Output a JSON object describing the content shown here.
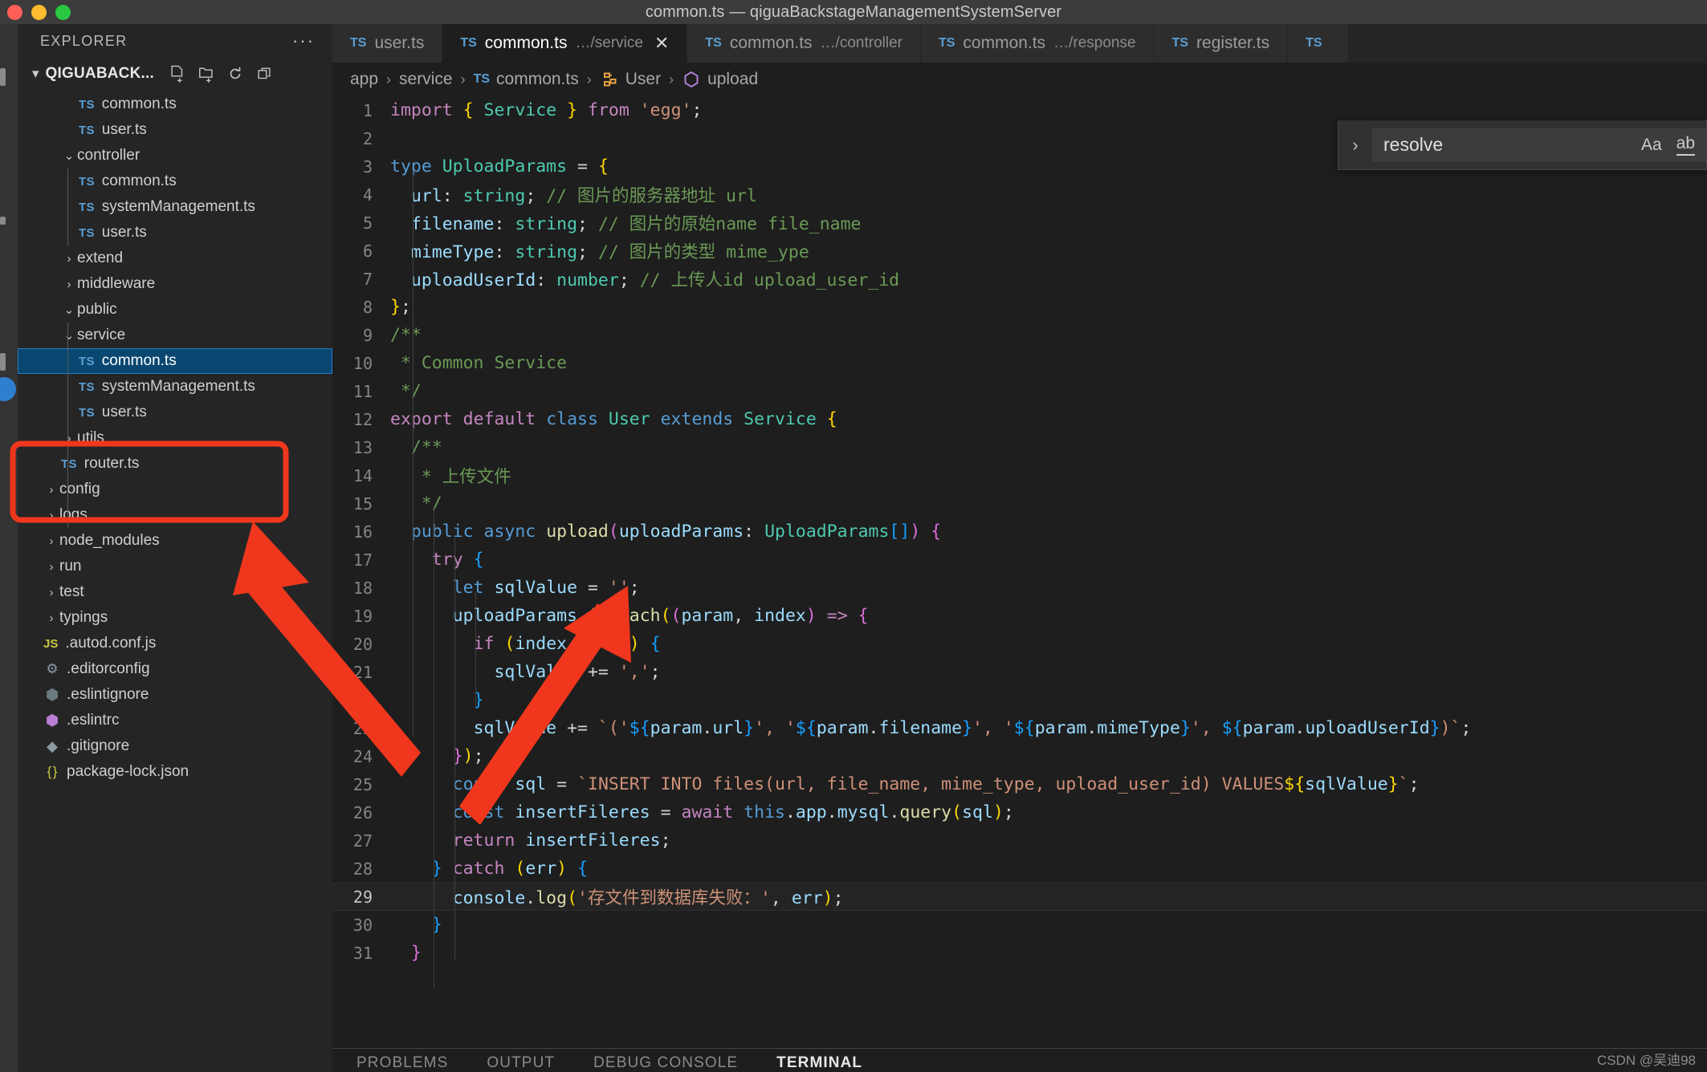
{
  "window": {
    "title": "common.ts — qiguaBackstageManagementSystemServer",
    "traffic_lights": [
      {
        "name": "close-button",
        "color": "#ff5f57"
      },
      {
        "name": "minimize-button",
        "color": "#febc2e"
      },
      {
        "name": "maximize-button",
        "color": "#28c840"
      }
    ]
  },
  "sidebar": {
    "header_label": "EXPLORER",
    "more_actions": "···",
    "project_name": "QIGUABACK...",
    "actions": [
      "new-file-icon",
      "new-folder-icon",
      "refresh-icon",
      "collapse-all-icon"
    ],
    "tree": [
      {
        "label": "common.ts",
        "kind": "ts",
        "indent": 3,
        "state": "none"
      },
      {
        "label": "user.ts",
        "kind": "ts",
        "indent": 3,
        "state": "none"
      },
      {
        "label": "controller",
        "kind": "folder",
        "indent": 2,
        "state": "expanded"
      },
      {
        "label": "common.ts",
        "kind": "ts",
        "indent": 3,
        "state": "none"
      },
      {
        "label": "systemManagement.ts",
        "kind": "ts",
        "indent": 3,
        "state": "none"
      },
      {
        "label": "user.ts",
        "kind": "ts",
        "indent": 3,
        "state": "none"
      },
      {
        "label": "extend",
        "kind": "folder",
        "indent": 2,
        "state": "collapsed"
      },
      {
        "label": "middleware",
        "kind": "folder",
        "indent": 2,
        "state": "collapsed"
      },
      {
        "label": "public",
        "kind": "folder",
        "indent": 2,
        "state": "expanded"
      },
      {
        "label": "service",
        "kind": "folder",
        "indent": 2,
        "state": "expanded",
        "highlight": true
      },
      {
        "label": "common.ts",
        "kind": "ts",
        "indent": 3,
        "state": "none",
        "selected": true,
        "highlight": true
      },
      {
        "label": "systemManagement.ts",
        "kind": "ts",
        "indent": 3,
        "state": "none"
      },
      {
        "label": "user.ts",
        "kind": "ts",
        "indent": 3,
        "state": "none"
      },
      {
        "label": "utils",
        "kind": "folder",
        "indent": 2,
        "state": "collapsed"
      },
      {
        "label": "router.ts",
        "kind": "ts",
        "indent": 2,
        "state": "none"
      },
      {
        "label": "config",
        "kind": "folder",
        "indent": 1,
        "state": "collapsed"
      },
      {
        "label": "logs",
        "kind": "folder",
        "indent": 1,
        "state": "collapsed"
      },
      {
        "label": "node_modules",
        "kind": "folder",
        "indent": 1,
        "state": "collapsed"
      },
      {
        "label": "run",
        "kind": "folder",
        "indent": 1,
        "state": "collapsed"
      },
      {
        "label": "test",
        "kind": "folder",
        "indent": 1,
        "state": "collapsed"
      },
      {
        "label": "typings",
        "kind": "folder",
        "indent": 1,
        "state": "collapsed"
      },
      {
        "label": ".autod.conf.js",
        "kind": "js",
        "indent": 1,
        "state": "none"
      },
      {
        "label": ".editorconfig",
        "kind": "gear",
        "indent": 1,
        "state": "none"
      },
      {
        "label": ".eslintignore",
        "kind": "eslint-dim",
        "indent": 1,
        "state": "none"
      },
      {
        "label": ".eslintrc",
        "kind": "eslint",
        "indent": 1,
        "state": "none"
      },
      {
        "label": ".gitignore",
        "kind": "git",
        "indent": 1,
        "state": "none"
      },
      {
        "label": "package-lock.json",
        "kind": "json",
        "indent": 1,
        "state": "none"
      }
    ]
  },
  "tabs": [
    {
      "name": "user.ts",
      "sub": "",
      "active": false,
      "close": false
    },
    {
      "name": "common.ts",
      "sub": "…/service",
      "active": true,
      "close": true
    },
    {
      "name": "common.ts",
      "sub": "…/controller",
      "active": false,
      "close": false
    },
    {
      "name": "common.ts",
      "sub": "…/response",
      "active": false,
      "close": false
    },
    {
      "name": "register.ts",
      "sub": "",
      "active": false,
      "close": false
    },
    {
      "name": "",
      "sub": "",
      "active": false,
      "close": false
    }
  ],
  "breadcrumb": [
    {
      "label": "app",
      "icon": ""
    },
    {
      "label": "service",
      "icon": ""
    },
    {
      "label": "common.ts",
      "icon": "ts"
    },
    {
      "label": "User",
      "icon": "class"
    },
    {
      "label": "upload",
      "icon": "method"
    }
  ],
  "find": {
    "query": "resolve",
    "match_case_label": "Aa",
    "whole_word_label": "ab",
    "toggle_icon": "chevron-right-icon"
  },
  "panel": {
    "tabs": [
      "PROBLEMS",
      "OUTPUT",
      "DEBUG CONSOLE",
      "TERMINAL"
    ],
    "active": "TERMINAL"
  },
  "watermark": "CSDN @吴迪98",
  "annotations": {
    "highlight_color": "#f0371d",
    "arrow_color": "#f0371d",
    "boxes": 1,
    "arrows": 2
  },
  "code": {
    "language": "TypeScript",
    "current_line": 29,
    "lines": [
      {
        "n": 1,
        "html": "<span class=\"k\">import</span> <span class=\"p1\">{</span> <span class=\"ty\">Service</span> <span class=\"p1\">}</span> <span class=\"k\">from</span> <span class=\"st\">'egg'</span><span class=\"op\">;</span>"
      },
      {
        "n": 2,
        "html": ""
      },
      {
        "n": 3,
        "html": "<span class=\"kb\">type</span> <span class=\"ty\">UploadParams</span> <span class=\"op\">=</span> <span class=\"p1\">{</span>"
      },
      {
        "n": 4,
        "html": "  <span class=\"va\">url</span><span class=\"op\">:</span> <span class=\"ty\">string</span><span class=\"op\">;</span> <span class=\"cm\">// 图片的服务器地址 url</span>"
      },
      {
        "n": 5,
        "html": "  <span class=\"va\">filename</span><span class=\"op\">:</span> <span class=\"ty\">string</span><span class=\"op\">;</span> <span class=\"cm\">// 图片的原始name file_name</span>"
      },
      {
        "n": 6,
        "html": "  <span class=\"va\">mimeType</span><span class=\"op\">:</span> <span class=\"ty\">string</span><span class=\"op\">;</span> <span class=\"cm\">// 图片的类型 mime_ype</span>"
      },
      {
        "n": 7,
        "html": "  <span class=\"va\">uploadUserId</span><span class=\"op\">:</span> <span class=\"ty\">number</span><span class=\"op\">;</span> <span class=\"cm\">// 上传人id upload_user_id</span>"
      },
      {
        "n": 8,
        "html": "<span class=\"p1\">}</span><span class=\"op\">;</span>"
      },
      {
        "n": 9,
        "html": "<span class=\"cm\">/**</span>"
      },
      {
        "n": 10,
        "html": "<span class=\"cm\"> * Common Service</span>"
      },
      {
        "n": 11,
        "html": "<span class=\"cm\"> */</span>"
      },
      {
        "n": 12,
        "html": "<span class=\"k\">export</span> <span class=\"k\">default</span> <span class=\"kb\">class</span> <span class=\"ty\">User</span> <span class=\"kb\">extends</span> <span class=\"ty\">Service</span> <span class=\"p1\">{</span>"
      },
      {
        "n": 13,
        "html": "  <span class=\"cm\">/**</span>"
      },
      {
        "n": 14,
        "html": "   <span class=\"cm\">* 上传文件</span>"
      },
      {
        "n": 15,
        "html": "   <span class=\"cm\">*/</span>"
      },
      {
        "n": 16,
        "html": "  <span class=\"kb\">public</span> <span class=\"kb\">async</span> <span class=\"fn\">upload</span><span class=\"p2\">(</span><span class=\"va\">uploadParams</span><span class=\"op\">:</span> <span class=\"ty\">UploadParams</span><span class=\"p3\">[]</span><span class=\"p2\">)</span> <span class=\"p2\">{</span>"
      },
      {
        "n": 17,
        "html": "    <span class=\"k\">try</span> <span class=\"p3\">{</span>"
      },
      {
        "n": 18,
        "html": "      <span class=\"kb\">let</span> <span class=\"va\">sqlValue</span> <span class=\"op\">=</span> <span class=\"st\">''</span><span class=\"op\">;</span>"
      },
      {
        "n": 19,
        "html": "      <span class=\"va\">uploadParams</span><span class=\"op\">.</span><span class=\"fn\">forEach</span><span class=\"p1\">(</span><span class=\"p2\">(</span><span class=\"va\">param</span><span class=\"op\">,</span> <span class=\"va\">index</span><span class=\"p2\">)</span> <span class=\"k\">=&gt;</span> <span class=\"p2\">{</span>"
      },
      {
        "n": 20,
        "html": "        <span class=\"k\">if</span> <span class=\"p1\">(</span><span class=\"va\">index</span> <span class=\"op\">!==</span> <span class=\"nu\">0</span><span class=\"p1\">)</span> <span class=\"p3\">{</span>"
      },
      {
        "n": 21,
        "html": "          <span class=\"va\">sqlValue</span> <span class=\"op\">+=</span> <span class=\"st\">','</span><span class=\"op\">;</span>"
      },
      {
        "n": 22,
        "html": "        <span class=\"p3\">}</span>"
      },
      {
        "n": 23,
        "html": "        <span class=\"va\">sqlValue</span> <span class=\"op\">+=</span> <span class=\"st\">`('</span><span class=\"p3\">${</span><span class=\"va\">param</span><span class=\"op\">.</span><span class=\"va\">url</span><span class=\"p3\">}</span><span class=\"st\">', '</span><span class=\"p3\">${</span><span class=\"va\">param</span><span class=\"op\">.</span><span class=\"va\">filename</span><span class=\"p3\">}</span><span class=\"st\">', '</span><span class=\"p3\">${</span><span class=\"va\">param</span><span class=\"op\">.</span><span class=\"va\">mimeType</span><span class=\"p3\">}</span><span class=\"st\">', </span><span class=\"p3\">${</span><span class=\"va\">param</span><span class=\"op\">.</span><span class=\"va\">uploadUserId</span><span class=\"p3\">}</span><span class=\"st\">)`</span><span class=\"op\">;</span>"
      },
      {
        "n": 24,
        "html": "      <span class=\"p2\">}</span><span class=\"p1\">)</span><span class=\"op\">;</span>"
      },
      {
        "n": 25,
        "html": "      <span class=\"kb\">const</span> <span class=\"va\">sql</span> <span class=\"op\">=</span> <span class=\"st\">`INSERT INTO files(url, file_name, mime_type, upload_user_id) VALUES</span><span class=\"p1\">${</span><span class=\"va\">sqlValue</span><span class=\"p1\">}</span><span class=\"st\">`</span><span class=\"op\">;</span>"
      },
      {
        "n": 26,
        "html": "      <span class=\"kb\">const</span> <span class=\"va\">insertFileres</span> <span class=\"op\">=</span> <span class=\"k\">await</span> <span class=\"kb\">this</span><span class=\"op\">.</span><span class=\"va\">app</span><span class=\"op\">.</span><span class=\"va\">mysql</span><span class=\"op\">.</span><span class=\"fn\">query</span><span class=\"p1\">(</span><span class=\"va\">sql</span><span class=\"p1\">)</span><span class=\"op\">;</span>"
      },
      {
        "n": 27,
        "html": "      <span class=\"k\">return</span> <span class=\"va\">insertFileres</span><span class=\"op\">;</span>"
      },
      {
        "n": 28,
        "html": "    <span class=\"p3\">}</span> <span class=\"k\">catch</span> <span class=\"p1\">(</span><span class=\"va\">err</span><span class=\"p1\">)</span> <span class=\"p3\">{</span>"
      },
      {
        "n": 29,
        "html": "      <span class=\"va\">console</span><span class=\"op\">.</span><span class=\"fn\">log</span><span class=\"p1\">(</span><span class=\"st\">'存文件到数据库失败：'</span><span class=\"op\">,</span> <span class=\"va\">err</span><span class=\"p1\">)</span><span class=\"op\">;</span>"
      },
      {
        "n": 30,
        "html": "    <span class=\"p3\">}</span>"
      },
      {
        "n": 31,
        "html": "  <span class=\"p2\">}</span>"
      }
    ]
  }
}
